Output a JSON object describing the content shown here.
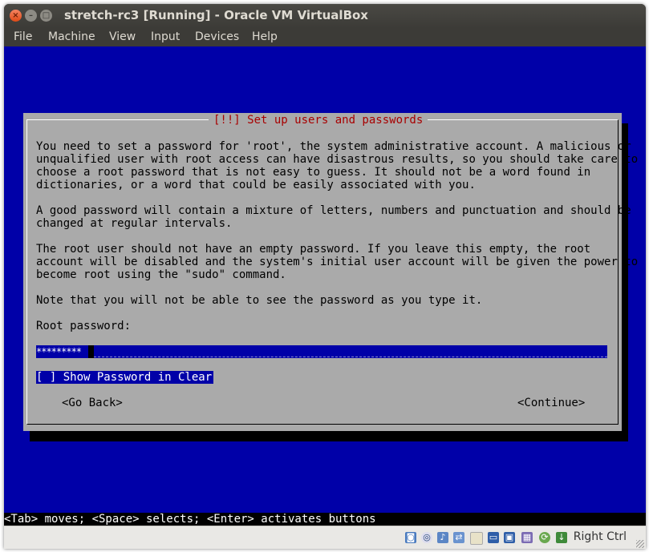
{
  "window": {
    "title": "stretch-rc3 [Running] - Oracle VM VirtualBox",
    "close_glyph": "×",
    "min_glyph": "–",
    "max_glyph": "□"
  },
  "menubar": {
    "items": [
      "File",
      "Machine",
      "View",
      "Input",
      "Devices",
      "Help"
    ]
  },
  "dialog": {
    "title": "[!!] Set up users and passwords",
    "paragraph1": "You need to set a password for 'root', the system administrative account. A malicious or\nunqualified user with root access can have disastrous results, so you should take care to\nchoose a root password that is not easy to guess. It should not be a word found in\ndictionaries, or a word that could be easily associated with you.",
    "paragraph2": "A good password will contain a mixture of letters, numbers and punctuation and should be\nchanged at regular intervals.",
    "paragraph3": "The root user should not have an empty password. If you leave this empty, the root\naccount will be disabled and the system's initial user account will be given the power to\nbecome root using the \"sudo\" command.",
    "paragraph4": "Note that you will not be able to see the password as you type it.",
    "password_label": "Root password:",
    "password_value": "*********",
    "show_password_checkbox": "[ ] Show Password in Clear",
    "go_back_button": "<Go Back>",
    "continue_button": "<Continue>"
  },
  "help_line": "<Tab> moves; <Space> selects; <Enter> activates buttons",
  "statusbar": {
    "host_key": "Right Ctrl",
    "icons": [
      "hard-disk-icon",
      "optical-drive-icon",
      "audio-icon",
      "network-icon",
      "shared-folders-icon",
      "display-icon",
      "video-capture-icon",
      "cpu-icon",
      "mouse-integration-icon",
      "keyboard-icon"
    ]
  },
  "colors": {
    "screen_bg": "#0000a8",
    "dialog_bg": "#aaaaaa",
    "dialog_title": "#a80000",
    "titlebar": "#3c3b37"
  }
}
